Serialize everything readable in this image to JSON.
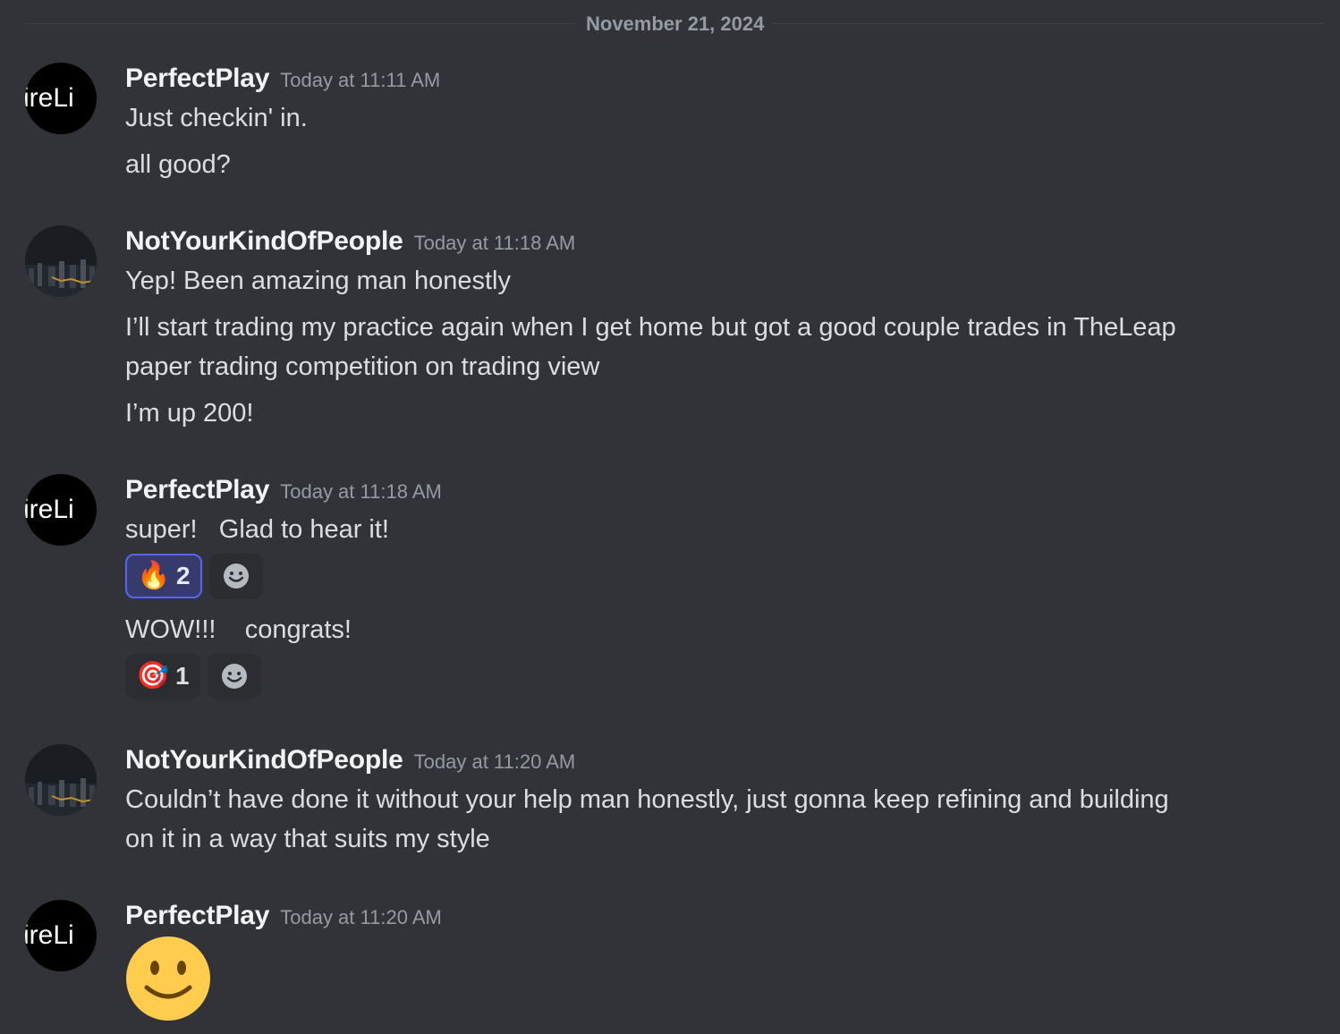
{
  "date_divider": "November 21, 2024",
  "messages": [
    {
      "author": "PerfectPlay",
      "avatar_text": "ireLi",
      "timestamp": "Today at 11:11 AM",
      "lines": [
        "Just checkin' in.",
        "all good?"
      ]
    },
    {
      "author": "NotYourKindOfPeople",
      "timestamp": "Today at 11:18 AM",
      "lines": [
        "Yep! Been amazing man honestly",
        "I’ll start trading my practice again when I get home but got a good couple trades in TheLeap",
        "paper trading competition on trading view",
        "I’m up 200!"
      ]
    },
    {
      "author": "PerfectPlay",
      "avatar_text": "ireLi",
      "timestamp": "Today at 11:18 AM",
      "lines": [
        "super!   Glad to hear it!",
        "WOW!!!    congrats!"
      ],
      "reactions": [
        {
          "emoji": "🔥",
          "icon": "fire-icon",
          "count": "2",
          "selected": true
        },
        {
          "emoji": "🎯",
          "icon": "target-icon",
          "count": "1",
          "selected": false
        }
      ]
    },
    {
      "author": "NotYourKindOfPeople",
      "timestamp": "Today at 11:20 AM",
      "lines": [
        "Couldn’t have done it without your help man honestly, just gonna keep refining and building",
        "on it in a way that suits my style"
      ]
    },
    {
      "author": "PerfectPlay",
      "avatar_text": "ireLi",
      "timestamp": "Today at 11:20 AM",
      "big_emoji": "slightly-smiling-face-icon"
    }
  ],
  "colors": {
    "background": "#313338",
    "username": "#f2f3f5",
    "timestamp": "#949ba4",
    "text": "#dbdee1",
    "reaction_selected_border": "#5865f2"
  }
}
